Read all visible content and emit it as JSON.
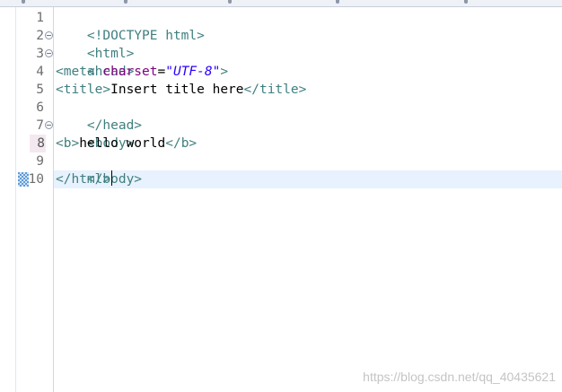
{
  "gutter": {
    "lines": [
      "1",
      "2",
      "3",
      "4",
      "5",
      "6",
      "7",
      "8",
      "9",
      "10"
    ]
  },
  "code": {
    "line1": {
      "open": "<!DOCTYPE html>"
    },
    "line2": {
      "tag": "<html>"
    },
    "line3": {
      "tag": "<head>"
    },
    "line4": {
      "open": "<meta ",
      "attr": "charset",
      "eq": "=",
      "value": "\"UTF-8\"",
      "close": ">"
    },
    "line5": {
      "open": "<title>",
      "text": "Insert title here",
      "close": "</title>"
    },
    "line6": {
      "tag": "</head>"
    },
    "line7": {
      "tag": "<body>"
    },
    "line8": {
      "open": "<b>",
      "text": "hello world",
      "close": "</b>"
    },
    "line9": {
      "tag": "</body>"
    },
    "line10": {
      "tag": "</html>"
    }
  },
  "watermark": "https://blog.csdn.net/qq_40435621",
  "colors": {
    "tag": "#3f7f7f",
    "attribute": "#7f007f",
    "string_value": "#2a00ff",
    "current_line_bg": "#e8f2fe",
    "line_number": "#6e6e6e"
  }
}
